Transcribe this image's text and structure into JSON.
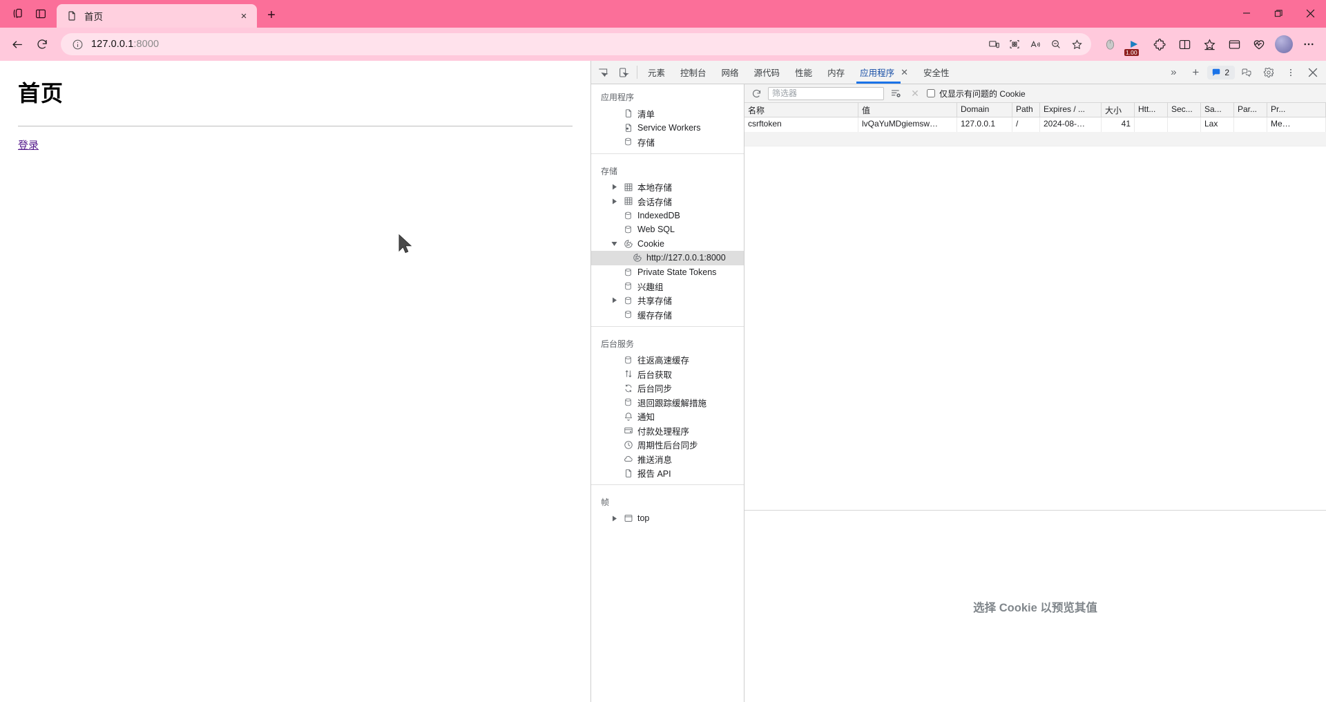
{
  "browser": {
    "tab": {
      "title": "首页",
      "favicon": "page-icon",
      "close_label": "×"
    },
    "newtab_label": "+",
    "toolbar": {
      "back": "back-arrow-icon",
      "reload": "reload-icon",
      "url": "127.0.0.1",
      "url_suffix": ":8000",
      "info_icon": "info-circle-icon"
    },
    "extension_badge": "1.00",
    "window": {
      "minimize": "—",
      "maximize": "❐",
      "close": "✕"
    }
  },
  "page": {
    "heading": "首页",
    "link": "登录"
  },
  "devtools": {
    "tabs": [
      {
        "label": "元素",
        "active": false
      },
      {
        "label": "控制台",
        "active": false
      },
      {
        "label": "网络",
        "active": false
      },
      {
        "label": "源代码",
        "active": false
      },
      {
        "label": "性能",
        "active": false
      },
      {
        "label": "内存",
        "active": false
      },
      {
        "label": "应用程序",
        "active": true,
        "closable": "✕"
      },
      {
        "label": "安全性",
        "active": false
      }
    ],
    "more_tabs": "»",
    "add_tab": "+",
    "messages_count": "2",
    "sidebar": {
      "sections": [
        {
          "title": "应用程序",
          "items": [
            {
              "label": "清单",
              "icon": "manifest-file-icon",
              "indent": 1,
              "twisty": "none"
            },
            {
              "label": "Service Workers",
              "icon": "service-worker-icon",
              "indent": 1,
              "twisty": "none"
            },
            {
              "label": "存储",
              "icon": "database-icon",
              "indent": 1,
              "twisty": "none"
            }
          ]
        },
        {
          "title": "存储",
          "items": [
            {
              "label": "本地存储",
              "icon": "table-grid-icon",
              "indent": 1,
              "twisty": "collapsed"
            },
            {
              "label": "会话存储",
              "icon": "table-grid-icon",
              "indent": 1,
              "twisty": "collapsed"
            },
            {
              "label": "IndexedDB",
              "icon": "database-icon",
              "indent": 1,
              "twisty": "none"
            },
            {
              "label": "Web SQL",
              "icon": "database-icon",
              "indent": 1,
              "twisty": "none"
            },
            {
              "label": "Cookie",
              "icon": "cookie-icon",
              "indent": 1,
              "twisty": "expanded"
            },
            {
              "label": "http://127.0.0.1:8000",
              "icon": "cookie-icon",
              "indent": 2,
              "twisty": "none",
              "selected": true
            },
            {
              "label": "Private State Tokens",
              "icon": "database-icon",
              "indent": 1,
              "twisty": "none"
            },
            {
              "label": "兴趣组",
              "icon": "database-icon",
              "indent": 1,
              "twisty": "none"
            },
            {
              "label": "共享存储",
              "icon": "database-icon",
              "indent": 1,
              "twisty": "collapsed"
            },
            {
              "label": "缓存存储",
              "icon": "database-icon",
              "indent": 1,
              "twisty": "none"
            }
          ]
        },
        {
          "title": "后台服务",
          "items": [
            {
              "label": "往返高速缓存",
              "icon": "database-icon",
              "indent": 1,
              "twisty": "none"
            },
            {
              "label": "后台获取",
              "icon": "arrows-updown-icon",
              "indent": 1,
              "twisty": "none"
            },
            {
              "label": "后台同步",
              "icon": "sync-icon",
              "indent": 1,
              "twisty": "none"
            },
            {
              "label": "退回跟踪缓解措施",
              "icon": "database-icon",
              "indent": 1,
              "twisty": "none"
            },
            {
              "label": "通知",
              "icon": "bell-icon",
              "indent": 1,
              "twisty": "none"
            },
            {
              "label": "付款处理程序",
              "icon": "card-icon",
              "indent": 1,
              "twisty": "none"
            },
            {
              "label": "周期性后台同步",
              "icon": "clock-icon",
              "indent": 1,
              "twisty": "none"
            },
            {
              "label": "推送消息",
              "icon": "cloud-icon",
              "indent": 1,
              "twisty": "none"
            },
            {
              "label": "报告 API",
              "icon": "report-file-icon",
              "indent": 1,
              "twisty": "none"
            }
          ]
        },
        {
          "title": "帧",
          "items": [
            {
              "label": "top",
              "icon": "frame-icon",
              "indent": 1,
              "twisty": "collapsed"
            }
          ]
        }
      ]
    },
    "cookie_panel": {
      "toolbar": {
        "refresh": "refresh-icon",
        "filter_placeholder": "筛选器",
        "filter_value": "",
        "clear_filtered": "clear-all-cookies-icon",
        "delete_selected": "✕",
        "issues_checkbox_label": "仅显示有问题的 Cookie",
        "issues_checked": false
      },
      "columns": [
        "名称",
        "值",
        "Domain",
        "Path",
        "Expires / ...",
        "大小",
        "Htt...",
        "Sec...",
        "Sa...",
        "Par...",
        "Pr..."
      ],
      "rows": [
        {
          "name": "csrftoken",
          "value": "lvQaYuMDgiemsw…",
          "domain": "127.0.0.1",
          "path": "/",
          "expires": "2024-08-…",
          "size": "41",
          "httponly": "",
          "secure": "",
          "samesite": "Lax",
          "partition": "",
          "priority": "Me…"
        }
      ],
      "preview_empty_text": "选择 Cookie 以预览其值"
    }
  }
}
